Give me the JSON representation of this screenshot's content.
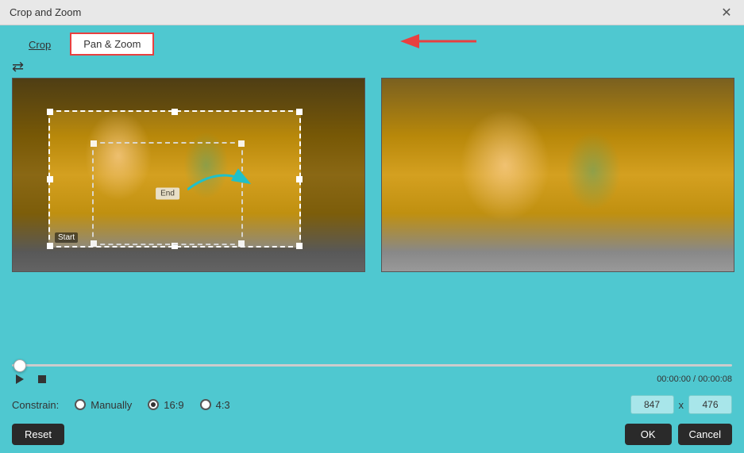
{
  "titleBar": {
    "title": "Crop and Zoom",
    "closeIcon": "✕"
  },
  "tabs": {
    "crop": "Crop",
    "panZoom": "Pan & Zoom"
  },
  "toolbar": {
    "repeatIcon": "⇄"
  },
  "leftPanel": {
    "startLabel": "Start",
    "endLabel": "End"
  },
  "scrubber": {
    "timeDisplay": "00:00:00 / 00:00:08"
  },
  "constrain": {
    "label": "Constrain:",
    "manually": "Manually",
    "ratio169": "16:9",
    "ratio43": "4:3",
    "width": "847",
    "height": "476"
  },
  "buttons": {
    "reset": "Reset",
    "ok": "OK",
    "cancel": "Cancel"
  }
}
